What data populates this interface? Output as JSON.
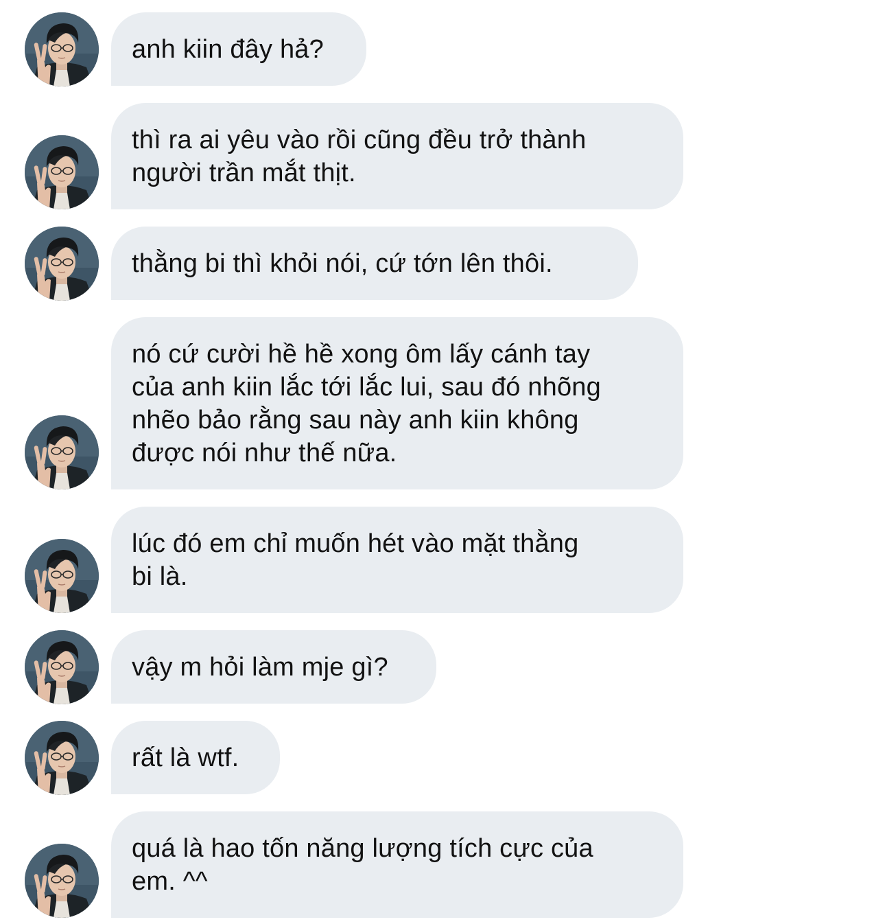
{
  "sender": {
    "avatar_icon": "profile-photo-avatar-icon"
  },
  "messages": [
    {
      "text": "anh kiin đây hả?",
      "avatar_shown": true
    },
    {
      "text": "thì ra ai yêu vào rồi cũng đều trở thành\nngười trần mắt thịt.",
      "avatar_shown": true
    },
    {
      "text": "thằng bi thì khỏi nói, cứ tớn lên thôi.",
      "avatar_shown": true
    },
    {
      "text": "nó cứ cười hề hề xong ôm lấy cánh tay\ncủa anh kiin lắc tới lắc lui, sau đó nhõng\nnhẽo bảo rằng sau này anh kiin không\nđược nói như thế nữa.",
      "avatar_shown": true
    },
    {
      "text": "lúc đó em chỉ muốn hét vào mặt thằng\nbi là.",
      "avatar_shown": true
    },
    {
      "text": "vậy m hỏi làm mje gì?",
      "avatar_shown": true
    },
    {
      "text": "rất là wtf.",
      "avatar_shown": true
    },
    {
      "text": "quá là hao tốn năng lượng tích cực của\nem. ^^",
      "avatar_shown": true
    }
  ],
  "colors": {
    "bubble_background": "#e9edf1",
    "text": "#121212",
    "page_background": "#ffffff"
  }
}
